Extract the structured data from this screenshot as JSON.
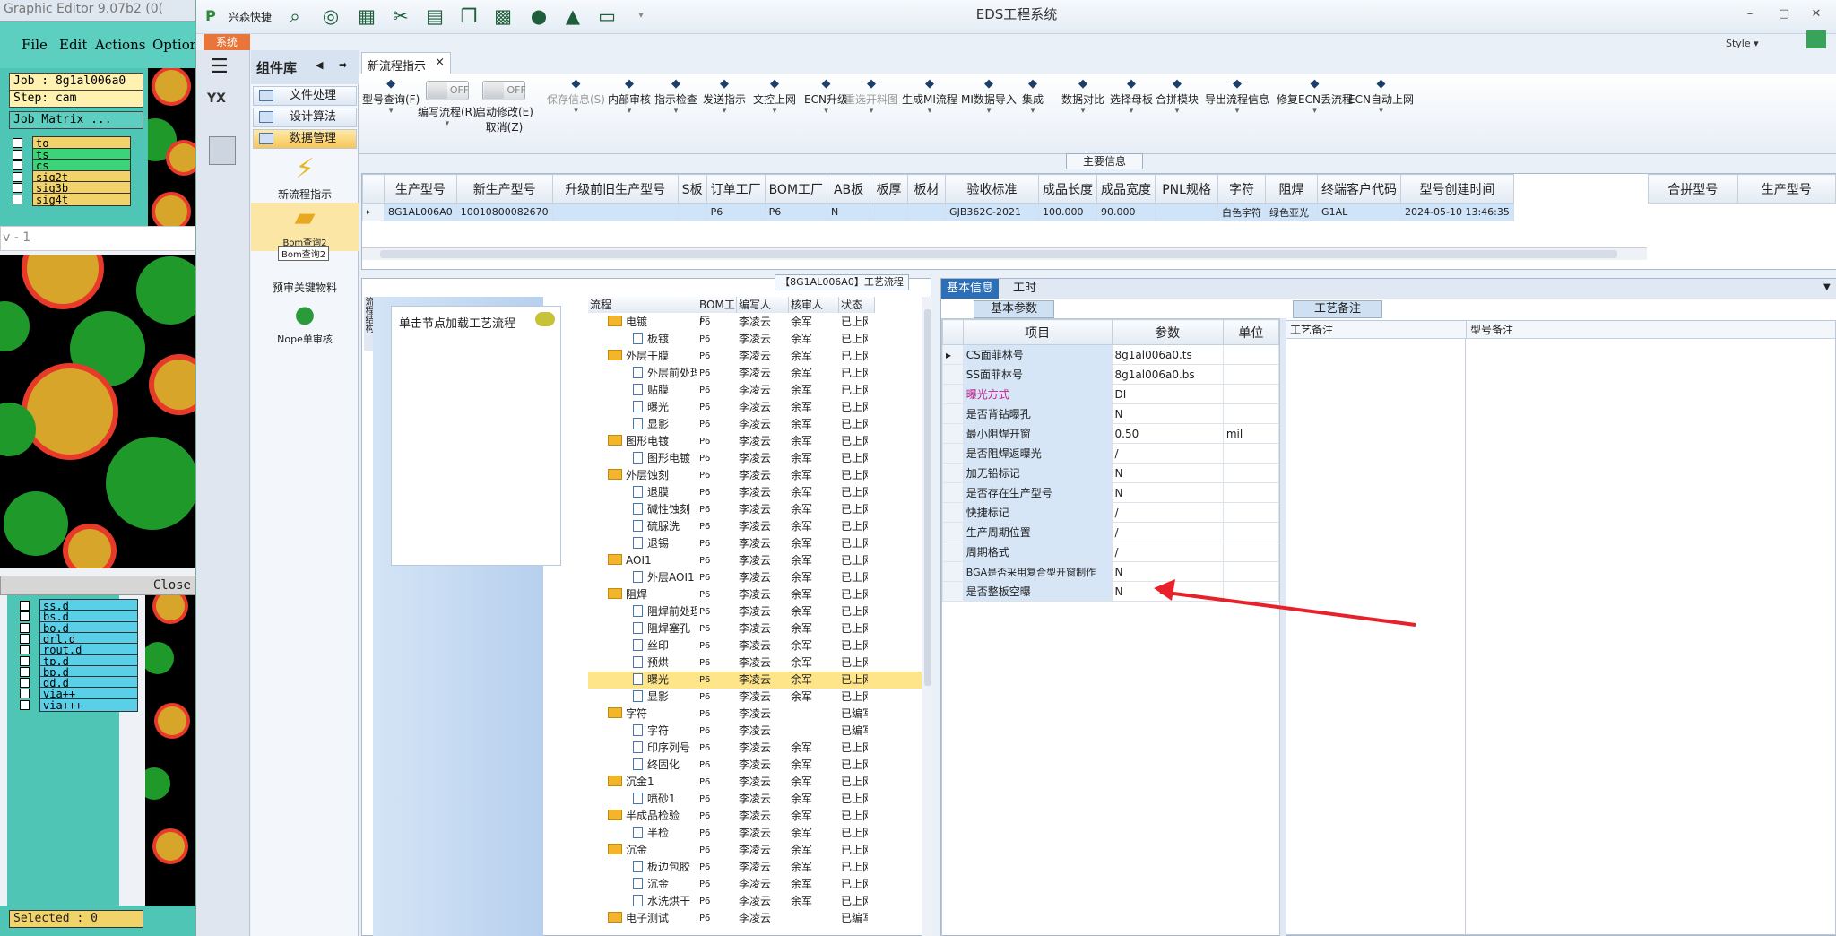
{
  "graphic_editor": {
    "title": "Graphic Editor 9.07b2 (0(",
    "menu": [
      "File",
      "Edit",
      "Actions",
      "Options"
    ],
    "job": "Job : 8g1al006a0",
    "step": "Step: cam",
    "job_matrix": "Job Matrix ...",
    "layers_top": [
      "to",
      "ts",
      "cs",
      "sig2t",
      "sig3b",
      "sig4t"
    ],
    "window_fragment": "v - 1",
    "close_label": "Close",
    "layers_bottom": [
      "ss.d",
      "bs.d",
      "bo.d",
      "drl.d",
      "rout.d",
      "tp.d",
      "bp.d",
      "dd.d",
      "via++",
      "via+++"
    ],
    "selected": "Selected : 0"
  },
  "app": {
    "title": "EDS工程系统",
    "quick_access_label": "兴森快捷",
    "style_label": "Style",
    "system_tab": "系统"
  },
  "component_panel": {
    "title": "组件库",
    "categories": [
      "文件处理",
      "设计算法",
      "数据管理"
    ],
    "items": [
      "新流程指示",
      "Bom查询2",
      "预审关键物料",
      "Nope单审核"
    ],
    "tooltip": "Bom查询2"
  },
  "doc_tab": {
    "label": "新流程指示",
    "close": "×"
  },
  "ribbon": {
    "buttons": [
      {
        "label": "型号查询(F)",
        "icon": "search-icon"
      },
      {
        "label": "编写流程(R)",
        "icon": "toggle"
      },
      {
        "label": "启动修改(E)",
        "label2": "取消(Z)",
        "icon": "toggle"
      },
      {
        "label": "保存信息(S)",
        "icon": "save-icon",
        "disabled": true
      },
      {
        "label": "内部审核",
        "icon": "print-icon"
      },
      {
        "label": "指示检查",
        "icon": "check-icon"
      },
      {
        "label": "发送指示",
        "icon": "upload-icon"
      },
      {
        "label": "文控上网",
        "icon": "cloud-icon"
      },
      {
        "label": "ECN升级",
        "icon": "font-icon"
      },
      {
        "label": "重选开料图",
        "icon": "image-icon",
        "disabled": true
      },
      {
        "label": "生成MI流程",
        "icon": "gears-icon"
      },
      {
        "label": "MI数据导入",
        "icon": "import-icon"
      },
      {
        "label": "集成",
        "icon": "download-icon"
      },
      {
        "label": "数据对比",
        "icon": "compare-icon"
      },
      {
        "label": "选择母板",
        "icon": "shuffle-icon"
      },
      {
        "label": "合拼模块",
        "icon": "list-icon"
      },
      {
        "label": "导出流程信息",
        "icon": "smile-icon"
      },
      {
        "label": "修复ECN丢流程",
        "icon": "wrench-icon"
      },
      {
        "label": "ECN自动上网",
        "icon": "star-icon"
      }
    ],
    "toggle_off": "OFF"
  },
  "main_info": {
    "label": "主要信息",
    "columns": [
      "生产型号",
      "新生产型号",
      "升级前旧生产型号",
      "S板",
      "订单工厂",
      "BOM工厂",
      "AB板",
      "板厚",
      "板材",
      "验收标准",
      "成品长度",
      "成品宽度",
      "PNL规格",
      "字符",
      "阻焊",
      "终端客户代码",
      "型号创建时间"
    ],
    "row": [
      "8G1AL006A0",
      "10010800082670",
      "",
      "",
      "P6",
      "P6",
      "N",
      "",
      "",
      "GJB362C-2021",
      "100.000",
      "90.000",
      "",
      "白色字符",
      "绿色亚光",
      "G1AL",
      "2024-05-10 13:46:35"
    ],
    "side_columns": [
      "合拼型号",
      "生产型号"
    ]
  },
  "process": {
    "title": "【8G1AL006A0】工艺流程",
    "side_label": "流程结构",
    "node_hint": "单击节点加载工艺流程",
    "columns": [
      "流程",
      "BOM工厂",
      "编写人",
      "核审人",
      "状态"
    ],
    "rows": [
      {
        "name": "电镀",
        "folder": true,
        "bom": "P6",
        "writer": "李凌云",
        "reviewer": "余军",
        "status": "已上网"
      },
      {
        "name": "板镀",
        "folder": false,
        "bom": "P6",
        "writer": "李凌云",
        "reviewer": "余军",
        "status": "已上网"
      },
      {
        "name": "外层干膜",
        "folder": true,
        "bom": "P6",
        "writer": "李凌云",
        "reviewer": "余军",
        "status": "已上网"
      },
      {
        "name": "外层前处理",
        "folder": false,
        "bom": "P6",
        "writer": "李凌云",
        "reviewer": "余军",
        "status": "已上网"
      },
      {
        "name": "贴膜",
        "folder": false,
        "bom": "P6",
        "writer": "李凌云",
        "reviewer": "余军",
        "status": "已上网"
      },
      {
        "name": "曝光",
        "folder": false,
        "bom": "P6",
        "writer": "李凌云",
        "reviewer": "余军",
        "status": "已上网"
      },
      {
        "name": "显影",
        "folder": false,
        "bom": "P6",
        "writer": "李凌云",
        "reviewer": "余军",
        "status": "已上网"
      },
      {
        "name": "图形电镀",
        "folder": true,
        "bom": "P6",
        "writer": "李凌云",
        "reviewer": "余军",
        "status": "已上网"
      },
      {
        "name": "图形电镀",
        "folder": false,
        "bom": "P6",
        "writer": "李凌云",
        "reviewer": "余军",
        "status": "已上网"
      },
      {
        "name": "外层蚀刻",
        "folder": true,
        "bom": "P6",
        "writer": "李凌云",
        "reviewer": "余军",
        "status": "已上网"
      },
      {
        "name": "退膜",
        "folder": false,
        "bom": "P6",
        "writer": "李凌云",
        "reviewer": "余军",
        "status": "已上网"
      },
      {
        "name": "碱性蚀刻",
        "folder": false,
        "bom": "P6",
        "writer": "李凌云",
        "reviewer": "余军",
        "status": "已上网"
      },
      {
        "name": "硫脲洗",
        "folder": false,
        "bom": "P6",
        "writer": "李凌云",
        "reviewer": "余军",
        "status": "已上网"
      },
      {
        "name": "退锡",
        "folder": false,
        "bom": "P6",
        "writer": "李凌云",
        "reviewer": "余军",
        "status": "已上网"
      },
      {
        "name": "AOI1",
        "folder": true,
        "bom": "P6",
        "writer": "李凌云",
        "reviewer": "余军",
        "status": "已上网"
      },
      {
        "name": "外层AOI1",
        "folder": false,
        "bom": "P6",
        "writer": "李凌云",
        "reviewer": "余军",
        "status": "已上网"
      },
      {
        "name": "阻焊",
        "folder": true,
        "bom": "P6",
        "writer": "李凌云",
        "reviewer": "余军",
        "status": "已上网"
      },
      {
        "name": "阻焊前处理",
        "folder": false,
        "bom": "P6",
        "writer": "李凌云",
        "reviewer": "余军",
        "status": "已上网"
      },
      {
        "name": "阻焊塞孔",
        "folder": false,
        "bom": "P6",
        "writer": "李凌云",
        "reviewer": "余军",
        "status": "已上网"
      },
      {
        "name": "丝印",
        "folder": false,
        "bom": "P6",
        "writer": "李凌云",
        "reviewer": "余军",
        "status": "已上网"
      },
      {
        "name": "预烘",
        "folder": false,
        "bom": "P6",
        "writer": "李凌云",
        "reviewer": "余军",
        "status": "已上网"
      },
      {
        "name": "曝光",
        "folder": false,
        "bom": "P6",
        "writer": "李凌云",
        "reviewer": "余军",
        "status": "已上网",
        "selected": true
      },
      {
        "name": "显影",
        "folder": false,
        "bom": "P6",
        "writer": "李凌云",
        "reviewer": "余军",
        "status": "已上网"
      },
      {
        "name": "字符",
        "folder": true,
        "bom": "P6",
        "writer": "李凌云",
        "reviewer": "",
        "status": "已编写"
      },
      {
        "name": "字符",
        "folder": false,
        "bom": "P6",
        "writer": "李凌云",
        "reviewer": "",
        "status": "已编写"
      },
      {
        "name": "印序列号",
        "folder": false,
        "bom": "P6",
        "writer": "李凌云",
        "reviewer": "余军",
        "status": "已上网"
      },
      {
        "name": "终固化",
        "folder": false,
        "bom": "P6",
        "writer": "李凌云",
        "reviewer": "余军",
        "status": "已上网"
      },
      {
        "name": "沉金1",
        "folder": true,
        "bom": "P6",
        "writer": "李凌云",
        "reviewer": "余军",
        "status": "已上网"
      },
      {
        "name": "喷砂1",
        "folder": false,
        "bom": "P6",
        "writer": "李凌云",
        "reviewer": "余军",
        "status": "已上网"
      },
      {
        "name": "半成品检验",
        "folder": true,
        "bom": "P6",
        "writer": "李凌云",
        "reviewer": "余军",
        "status": "已上网"
      },
      {
        "name": "半检",
        "folder": false,
        "bom": "P6",
        "writer": "李凌云",
        "reviewer": "余军",
        "status": "已上网"
      },
      {
        "name": "沉金",
        "folder": true,
        "bom": "P6",
        "writer": "李凌云",
        "reviewer": "余军",
        "status": "已上网"
      },
      {
        "name": "板边包胶",
        "folder": false,
        "bom": "P6",
        "writer": "李凌云",
        "reviewer": "余军",
        "status": "已上网"
      },
      {
        "name": "沉金",
        "folder": false,
        "bom": "P6",
        "writer": "李凌云",
        "reviewer": "余军",
        "status": "已上网"
      },
      {
        "name": "水洗烘干",
        "folder": false,
        "bom": "P6",
        "writer": "李凌云",
        "reviewer": "余军",
        "status": "已上网"
      },
      {
        "name": "电子测试",
        "folder": true,
        "bom": "P6",
        "writer": "李凌云",
        "reviewer": "",
        "status": "已编写"
      }
    ]
  },
  "basic_info": {
    "tabs": [
      "基本信息",
      "工时"
    ],
    "sub_tab": "基本参数",
    "columns": [
      "项目",
      "参数",
      "单位"
    ],
    "rows": [
      {
        "item": "CS面菲林号",
        "value": "8g1al006a0.ts",
        "unit": ""
      },
      {
        "item": "SS面菲林号",
        "value": "8g1al006a0.bs",
        "unit": ""
      },
      {
        "item": "曝光方式",
        "value": "DI",
        "unit": "",
        "highlight": true
      },
      {
        "item": "是否背钻曝孔",
        "value": "N",
        "unit": ""
      },
      {
        "item": "最小阻焊开窗",
        "value": "0.50",
        "unit": "mil"
      },
      {
        "item": "是否阻焊返曝光",
        "value": "/",
        "unit": ""
      },
      {
        "item": "加无铅标记",
        "value": "N",
        "unit": ""
      },
      {
        "item": "是否存在生产型号",
        "value": "N",
        "unit": ""
      },
      {
        "item": "快捷标记",
        "value": "/",
        "unit": ""
      },
      {
        "item": "生产周期位置",
        "value": "/",
        "unit": ""
      },
      {
        "item": "周期格式",
        "value": "/",
        "unit": ""
      },
      {
        "item": "BGA是否采用复合型开窗制作",
        "value": "N",
        "unit": ""
      },
      {
        "item": "是否整板空曝",
        "value": "N",
        "unit": ""
      }
    ],
    "craft_tab": "工艺备注",
    "craft_columns": [
      "工艺备注",
      "型号备注"
    ]
  },
  "colors": {
    "accent": "#2d6fb7",
    "highlight_row": "#ffe58a",
    "arrow": "#e8202a",
    "system_tab": "#e8763b"
  }
}
